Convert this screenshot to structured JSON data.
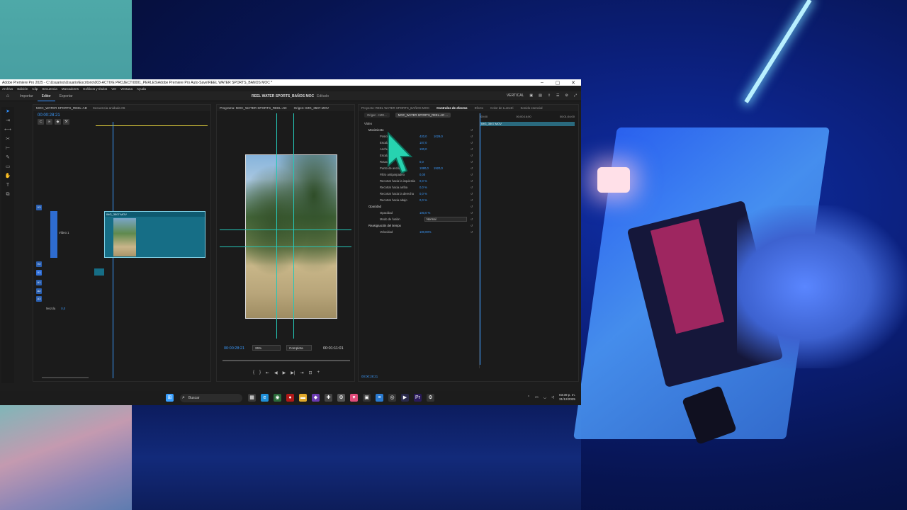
{
  "window": {
    "title": "Adobe Premiere Pro 2025 - C:\\Usuarios\\Usuario\\Escritorio\\003-ACTIVE PROJECT\\0001_PERLES\\Adobe Premiere Pro Auto-Save\\REEL WATER SPORTS_BAÑOS MOC *",
    "controls": [
      "–",
      "▢",
      "✕"
    ]
  },
  "menu": [
    "Archivo",
    "Edición",
    "Clip",
    "Secuencia",
    "Marcadores",
    "Gráficos y títulos",
    "Ver",
    "Ventana",
    "Ayuda"
  ],
  "header": {
    "tabs": [
      "Importar",
      "Editor",
      "Exportar"
    ],
    "active_tab": "Editor",
    "doc_title": "REEL WATER SPORTS_BAÑOS MOC",
    "doc_status": "Editado",
    "layout_label": "VERTICAL"
  },
  "timeline": {
    "tabs": [
      "MOC_WATER SPORTS_REEL-AD",
      "Secuencia anidada 06"
    ],
    "timecode": "00:00:28:21",
    "clip_label": "IMG_3507.MOV",
    "track_v1": "Vídeo 1",
    "tracks": [
      "V3",
      "V2",
      "V1",
      "A1",
      "A2",
      "A3"
    ],
    "mezcla_label": "Mezcla",
    "mezcla_value": "0,0"
  },
  "program": {
    "tabs": [
      "Programa: MOC_WATER SPORTS_REEL-AD",
      "Origen: IMG_3507.MOV"
    ],
    "timecode": "00:00:28:21",
    "zoom": "26%",
    "quality": "Completa",
    "duration": "00:01:11:01"
  },
  "effects": {
    "tabs": [
      "Proyecto: REEL WATER SPORTS_BAÑOS MOC",
      "Controles de efectos",
      "Efecto",
      "Color de Lumetri",
      "Sonido esencial"
    ],
    "active_tab": "Controles de efectos",
    "sub": [
      "Origen · IMG...",
      "MOC_WATER SPORTS_REEL-AD ..."
    ],
    "section_video": "Vídeo",
    "rows": [
      {
        "type": "hdr",
        "name": "Movimiento"
      },
      {
        "type": "prop",
        "name": "Posición",
        "v1": "420,0",
        "v2": "1029,0"
      },
      {
        "type": "prop",
        "name": "Escala",
        "v1": "107,0",
        "v2": ""
      },
      {
        "type": "prop",
        "name": "Anchura",
        "v1": "100,0",
        "v2": ""
      },
      {
        "type": "check",
        "name": "Escala uniforme",
        "v1": "",
        "v2": ""
      },
      {
        "type": "prop",
        "name": "Rotación",
        "v1": "0,0",
        "v2": ""
      },
      {
        "type": "prop",
        "name": "Punto de anclaje",
        "v1": "1080,0",
        "v2": "1920,0"
      },
      {
        "type": "prop",
        "name": "Filtro antiparpadeo",
        "v1": "0,00",
        "v2": ""
      },
      {
        "type": "prop",
        "name": "Recortar hacia la izquierda",
        "v1": "0,0 %",
        "v2": ""
      },
      {
        "type": "prop",
        "name": "Recortar hacia arriba",
        "v1": "0,0 %",
        "v2": ""
      },
      {
        "type": "prop",
        "name": "Recortar hacia la derecha",
        "v1": "0,0 %",
        "v2": ""
      },
      {
        "type": "prop",
        "name": "Recortar hacia abajo",
        "v1": "0,0 %",
        "v2": ""
      },
      {
        "type": "hdr",
        "name": "Opacidad"
      },
      {
        "type": "prop",
        "name": "Opacidad",
        "v1": "100,0 %",
        "v2": ""
      },
      {
        "type": "prop",
        "name": "Modo de fusión",
        "v1": "Normal",
        "v2": ""
      },
      {
        "type": "hdr",
        "name": "Reasignación del tiempo"
      },
      {
        "type": "prop",
        "name": "Velocidad",
        "v1": "100,00%",
        "v2": ""
      }
    ],
    "mini_times": [
      ";00;00",
      "00;00;16;00",
      "00;01;04;00"
    ],
    "mini_clip": "IMG_3507.MOV",
    "footer_time": "00:00:28:21"
  },
  "taskbar": {
    "search_placeholder": "Buscar",
    "time": "03:39 p. m.",
    "date": "31/12/2025"
  }
}
